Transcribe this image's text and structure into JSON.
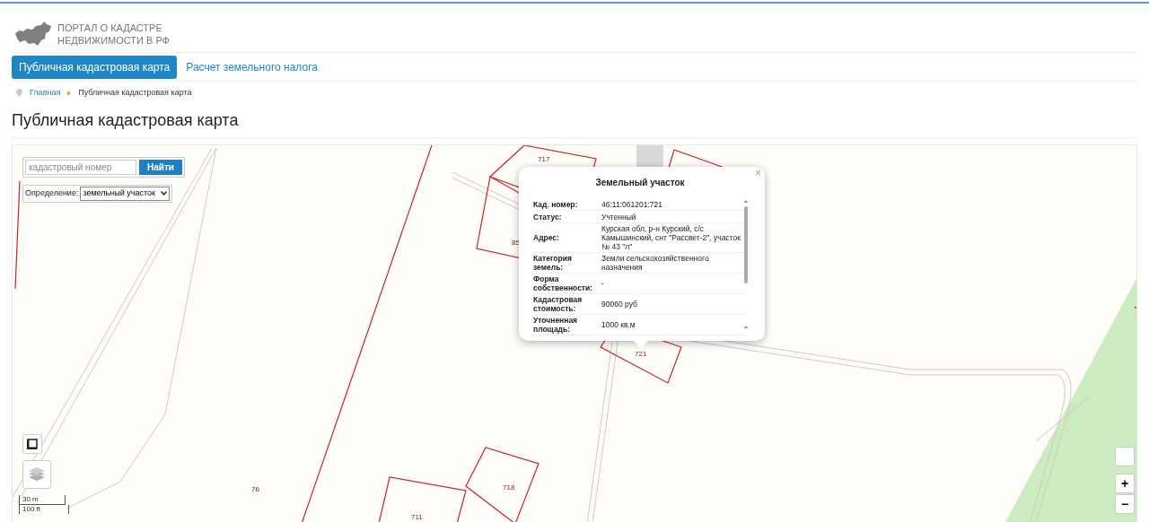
{
  "header": {
    "logo_lines": [
      "ПОРТАЛ О КАДАСТРЕ",
      "НЕДВИЖИМОСТИ В РФ"
    ]
  },
  "nav": [
    {
      "label": "Публичная кадастровая карта",
      "selected": true
    },
    {
      "label": "Расчет земельного налога",
      "selected": false
    }
  ],
  "breadcrumb": [
    {
      "label": "Главная",
      "kind": "link"
    },
    {
      "label": "Публичная кадастровая карта",
      "kind": "current"
    }
  ],
  "page_title": "Публичная кадастровая карта",
  "map": {
    "search": {
      "placeholder": "кадастровый номер",
      "button": "Найти"
    },
    "definition": {
      "label": "Определение:",
      "value": "земельный участок"
    },
    "parcel_labels": [
      "717",
      "85",
      "721",
      "718",
      "711",
      "76"
    ],
    "scale": [
      "30 m",
      "100 ft"
    ],
    "zoom_in": "+",
    "zoom_out": "−",
    "popup": {
      "title": "Земельный участок",
      "close": "×",
      "fields": [
        {
          "label": "Кад. номер:",
          "value": "46:11:061201:721"
        },
        {
          "label": "Статус:",
          "value": "Учтенный"
        },
        {
          "label": "Адрес:",
          "value": "Курская обл, р-н Курский, с/с Камышинский, снт \"Рассвет-2\", участок № 43 \"л\""
        },
        {
          "label": "Категория земель:",
          "value": "Земли сельскохозяйственного назначения"
        },
        {
          "label": "Форма собственности:",
          "value": "-"
        },
        {
          "label": "Кадастровая стоимость:",
          "value": "90060 руб"
        },
        {
          "label": "Уточненная площадь:",
          "value": "1000 кв.м"
        }
      ]
    }
  }
}
